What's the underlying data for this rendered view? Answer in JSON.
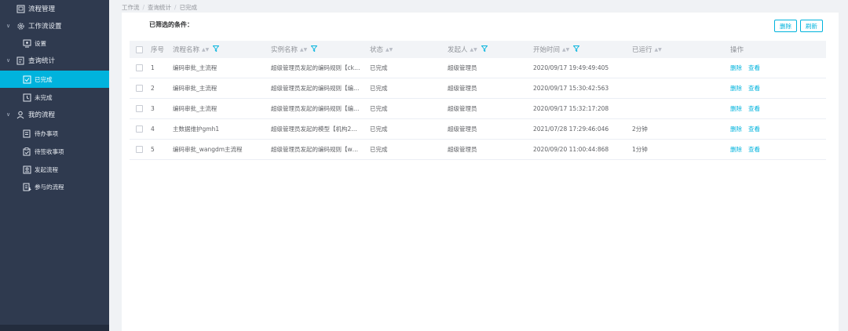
{
  "sidebar": {
    "items": [
      {
        "label": "流程管理",
        "icon": "flow-manage-icon",
        "arrow": ""
      },
      {
        "label": "工作流设置",
        "icon": "gear-icon",
        "arrow": "∨"
      },
      {
        "label": "设置",
        "icon": "monitor-icon",
        "arrow": ""
      },
      {
        "label": "查询统计",
        "icon": "chart-doc-icon",
        "arrow": "∨"
      },
      {
        "label": "已完成",
        "icon": "check-square-icon",
        "arrow": ""
      },
      {
        "label": "未完成",
        "icon": "clock-square-icon",
        "arrow": ""
      },
      {
        "label": "我的流程",
        "icon": "user-flow-icon",
        "arrow": "∨"
      },
      {
        "label": "待办事项",
        "icon": "todo-doc-icon",
        "arrow": ""
      },
      {
        "label": "待签收事项",
        "icon": "sign-doc-icon",
        "arrow": ""
      },
      {
        "label": "发起流程",
        "icon": "launch-icon",
        "arrow": ""
      },
      {
        "label": "参与的流程",
        "icon": "participate-icon",
        "arrow": ""
      }
    ],
    "active_index": 4
  },
  "breadcrumb": [
    "工作流",
    "查询统计",
    "已完成"
  ],
  "filter_title": "已筛选的条件：",
  "buttons": {
    "delete": "删除",
    "refresh": "刷新"
  },
  "table": {
    "headers": [
      "序号",
      "流程名称",
      "实例名称",
      "状态",
      "发起人",
      "开始时间",
      "已运行",
      "操作"
    ],
    "rows": [
      {
        "index": "1",
        "name": "编码审批_主流程",
        "instance": "超级管理员发起的编码规则【ck…",
        "status": "已完成",
        "initiator": "超级管理员",
        "start": "2020/09/17 19:49:49:405",
        "elapsed": ""
      },
      {
        "index": "2",
        "name": "编码审批_主流程",
        "instance": "超级管理员发起的编码规则【编…",
        "status": "已完成",
        "initiator": "超级管理员",
        "start": "2020/09/17 15:30:42:563",
        "elapsed": ""
      },
      {
        "index": "3",
        "name": "编码审批_主流程",
        "instance": "超级管理员发起的编码规则【编…",
        "status": "已完成",
        "initiator": "超级管理员",
        "start": "2020/09/17 15:32:17:208",
        "elapsed": ""
      },
      {
        "index": "4",
        "name": "主数据维护gmh1",
        "instance": "超级管理员发起的模型【机构2…",
        "status": "已完成",
        "initiator": "超级管理员",
        "start": "2021/07/28 17:29:46:046",
        "elapsed": "2分钟"
      },
      {
        "index": "5",
        "name": "编码审批_wangdm主流程",
        "instance": "超级管理员发起的编码规则【w…",
        "status": "已完成",
        "initiator": "超级管理员",
        "start": "2020/09/20 11:00:44:868",
        "elapsed": "1分钟"
      }
    ],
    "action_delete": "删除",
    "action_view": "查看"
  },
  "colors": {
    "sidebar_bg": "#2f3a4f",
    "accent": "#00b3dd",
    "header_bg": "#f2f4f7"
  }
}
